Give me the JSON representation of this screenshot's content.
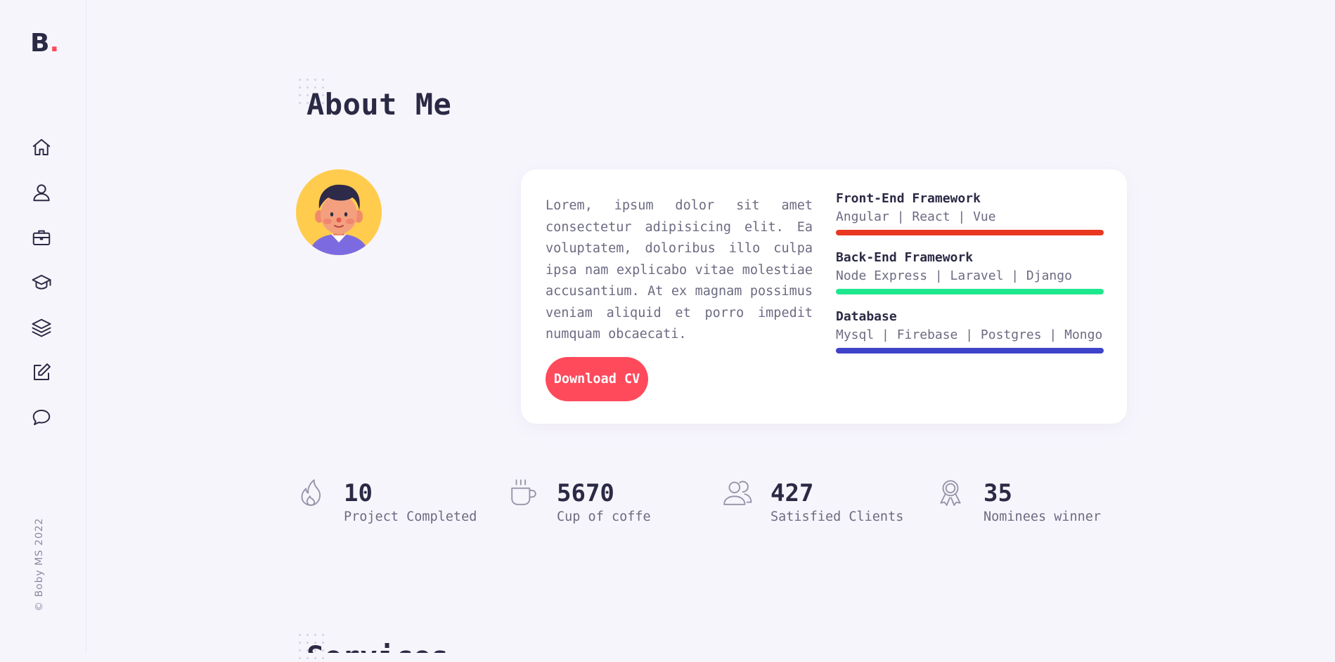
{
  "logo": {
    "letter": "B",
    "dot": "."
  },
  "nav": [
    {
      "name": "home",
      "icon": "home-icon"
    },
    {
      "name": "about",
      "icon": "user-icon"
    },
    {
      "name": "portfolio",
      "icon": "briefcase-icon"
    },
    {
      "name": "education",
      "icon": "graduation-cap-icon"
    },
    {
      "name": "services",
      "icon": "layers-icon"
    },
    {
      "name": "blog",
      "icon": "edit-icon"
    },
    {
      "name": "contact",
      "icon": "chat-bubble-icon"
    }
  ],
  "copyright": "© Boby MS 2022",
  "about": {
    "title": "About Me",
    "bio": "Lorem, ipsum dolor sit amet consectetur adipisicing elit. Ea voluptatem, doloribus illo culpa ipsa nam explicabo vitae molestiae accusantium. At ex magnam possimus veniam aliquid et porro impedit numquam obcaecati.",
    "download_label": "Download CV",
    "skills": [
      {
        "name": "Front-End Framework",
        "list": "Angular | React | Vue",
        "color": "#e8381f"
      },
      {
        "name": "Back-End Framework",
        "list": "Node Express | Laravel | Django",
        "color": "#1ee88e"
      },
      {
        "name": "Database",
        "list": "Mysql | Firebase | Postgres | Mongo",
        "color": "#3f43c9"
      }
    ]
  },
  "stats": [
    {
      "value": "10",
      "label": "Project Completed",
      "icon": "fire-icon"
    },
    {
      "value": "5670",
      "label": "Cup of coffe",
      "icon": "coffee-cup-icon"
    },
    {
      "value": "427",
      "label": "Satisfied Clients",
      "icon": "users-icon"
    },
    {
      "value": "35",
      "label": "Nominees winner",
      "icon": "award-icon"
    }
  ],
  "next_section": {
    "title": "Services"
  }
}
